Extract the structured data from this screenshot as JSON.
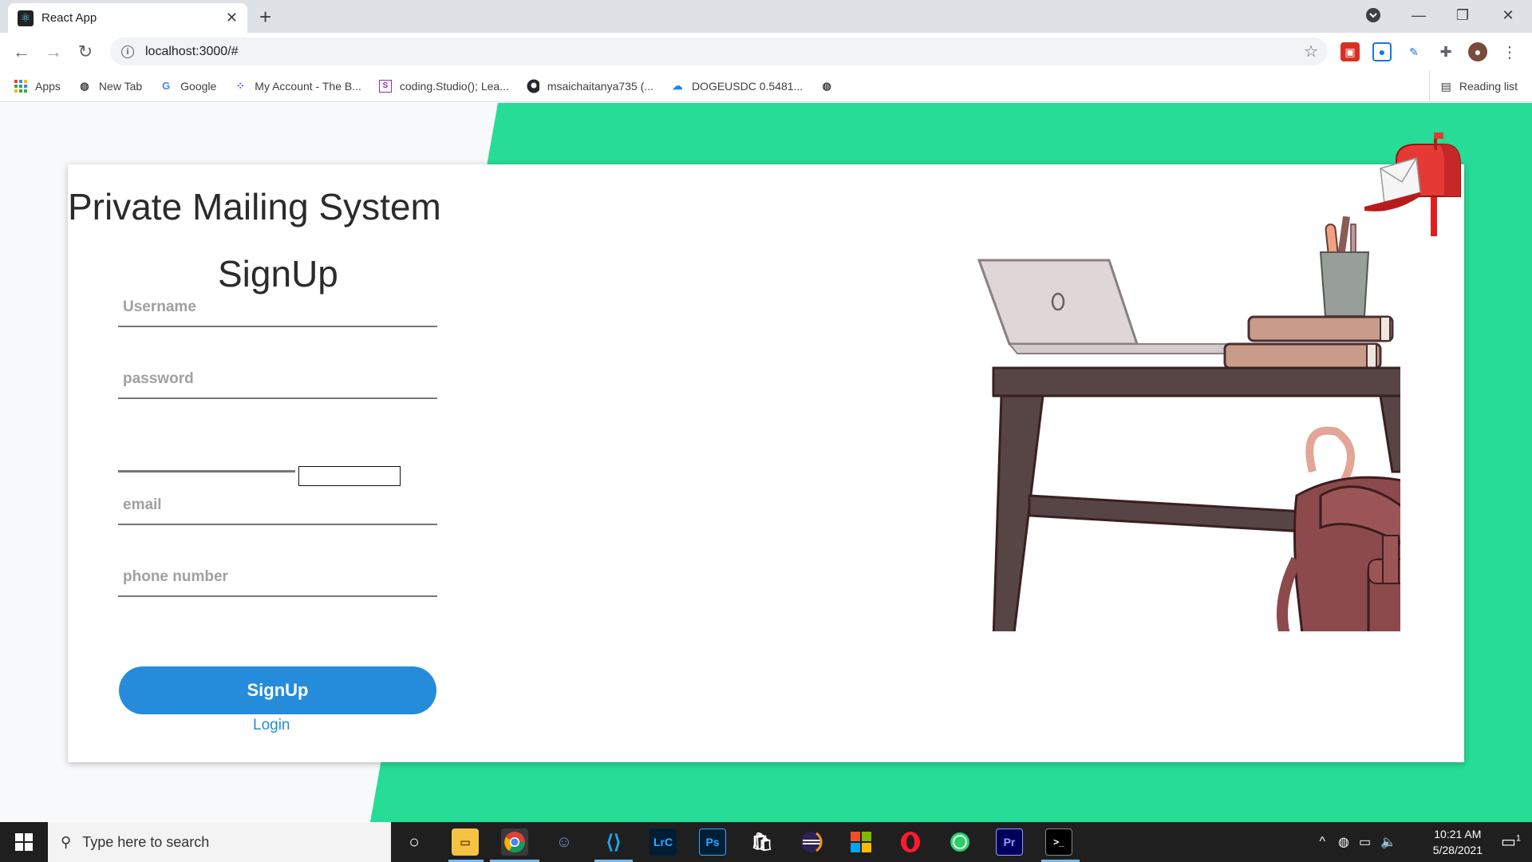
{
  "browser": {
    "tab_title": "React App",
    "tab_favicon": "react-icon",
    "url": "localhost:3000/#",
    "bookmarks": [
      {
        "label": "Apps",
        "icon": "apps-grid-icon"
      },
      {
        "label": "New Tab",
        "icon": "globe-icon"
      },
      {
        "label": "Google",
        "icon": "google-icon"
      },
      {
        "label": "My Account - The B...",
        "icon": "account-icon"
      },
      {
        "label": "coding.Studio(); Lea...",
        "icon": "codingstudio-icon"
      },
      {
        "label": "msaichaitanya735 (...",
        "icon": "github-icon"
      },
      {
        "label": "DOGEUSDC 0.5481...",
        "icon": "doge-icon"
      }
    ],
    "reading_list": "Reading list"
  },
  "page": {
    "app_title": "Private Mailing System",
    "form_title": "SignUp",
    "fields": {
      "username_placeholder": "Username",
      "password_placeholder": "password",
      "email_placeholder": "email",
      "phone_placeholder": "phone number"
    },
    "signup_button": "SignUp",
    "login_link": "Login"
  },
  "taskbar": {
    "search_placeholder": "Type here to search",
    "time": "10:21 AM",
    "date": "5/28/2021",
    "notification_count": "1"
  },
  "colors": {
    "accent_green": "#26dc96",
    "button_blue": "#258cdb"
  }
}
